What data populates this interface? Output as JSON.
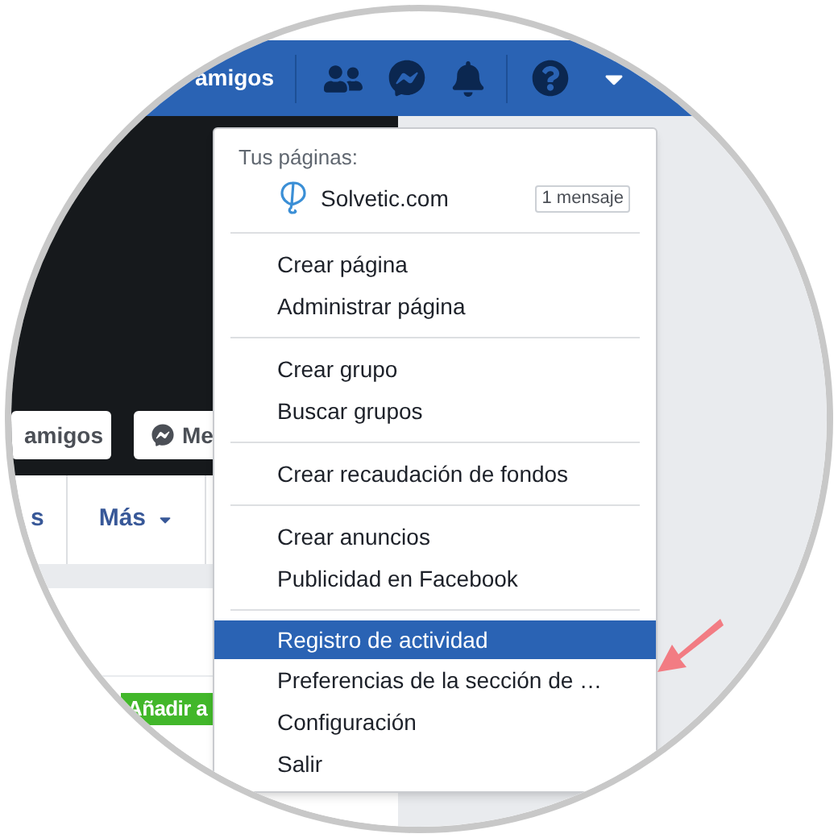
{
  "top_bar": {
    "friends_link": "amigos"
  },
  "profile_actions": [
    {
      "label": "amigos",
      "kind": "plain"
    },
    {
      "label": "Me",
      "kind": "messenger"
    }
  ],
  "tabs": [
    {
      "label": "s",
      "kind": "text"
    },
    {
      "label": "Más",
      "kind": "dropdown"
    }
  ],
  "add_button": "Añadir a",
  "menu": {
    "header": "Tus páginas:",
    "page": {
      "name": "Solvetic.com",
      "badge": "1 mensaje"
    },
    "groups": [
      {
        "items": [
          {
            "label": "Crear página",
            "selected": false
          },
          {
            "label": "Administrar página",
            "selected": false
          }
        ]
      },
      {
        "items": [
          {
            "label": "Crear grupo",
            "selected": false
          },
          {
            "label": "Buscar grupos",
            "selected": false
          }
        ]
      },
      {
        "items": [
          {
            "label": "Crear recaudación de fondos",
            "selected": false
          }
        ]
      },
      {
        "items": [
          {
            "label": "Crear anuncios",
            "selected": false
          },
          {
            "label": "Publicidad en Facebook",
            "selected": false
          }
        ]
      },
      {
        "items": [
          {
            "label": "Registro de actividad",
            "selected": true
          },
          {
            "label": "Preferencias de la sección de …",
            "selected": false
          },
          {
            "label": "Configuración",
            "selected": false
          },
          {
            "label": "Salir",
            "selected": false
          }
        ]
      }
    ]
  }
}
